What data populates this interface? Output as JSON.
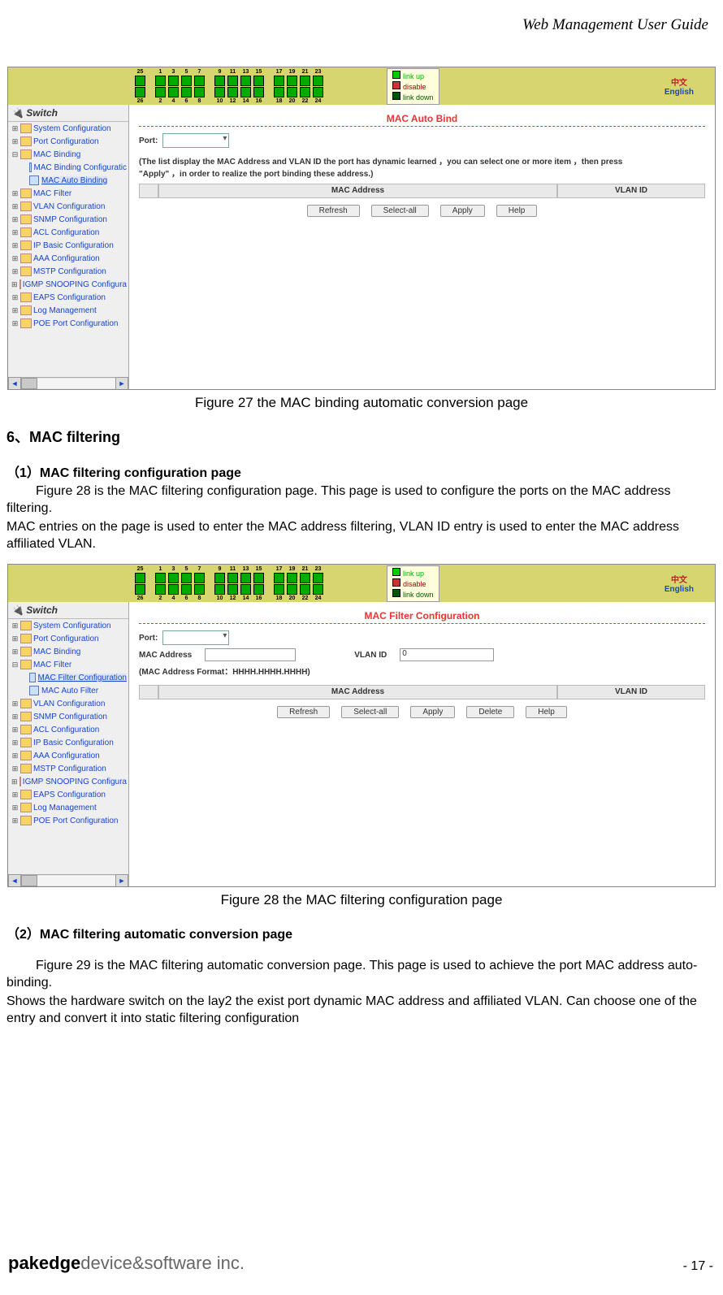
{
  "header_title": "Web Management User Guide",
  "fig27": {
    "caption": "Figure 27    the MAC binding automatic conversion page",
    "title": "MAC Auto Bind",
    "port_label": "Port:",
    "note": "(The list display the MAC Address and VLAN ID the port has dynamic learned ，you can select one or more item ，then press \"Apply\" ，in order to realize the port binding these address.)",
    "col1": "MAC Address",
    "col2": "VLAN ID",
    "buttons": [
      "Refresh",
      "Select-all",
      "Apply",
      "Help"
    ],
    "sidebar_title": "Switch",
    "tree": [
      "System Configuration",
      "Port Configuration",
      "MAC Binding",
      "MAC Binding Configuratic",
      "MAC Auto Binding",
      "MAC Filter",
      "VLAN Configuration",
      "SNMP Configuration",
      "ACL Configuration",
      "IP Basic Configuration",
      "AAA Configuration",
      "MSTP Configuration",
      "IGMP SNOOPING Configura",
      "EAPS Configuration",
      "Log Management",
      "POE Port Configuration"
    ],
    "status": [
      "link up",
      "disable",
      "link down"
    ],
    "lang_cn": "中文",
    "lang_en": "English"
  },
  "section6": {
    "heading": "6、MAC filtering",
    "sub1": "（1）MAC filtering configuration page",
    "p1a": "Figure 28 is the MAC filtering configuration page. This page is used to configure the ports on the MAC address filtering.",
    "p1b": "MAC entries on the page is used to enter the MAC address filtering, VLAN ID entry is used to enter the MAC address affiliated VLAN."
  },
  "fig28": {
    "caption": "Figure 28    the MAC filtering configuration page",
    "title": "MAC Filter Configuration",
    "port_label": "Port:",
    "mac_label": "MAC Address",
    "vlan_label": "VLAN ID",
    "vlan_value": "0",
    "format": "(MAC Address Format：HHHH.HHHH.HHHH)",
    "col1": "MAC Address",
    "col2": "VLAN ID",
    "buttons": [
      "Refresh",
      "Select-all",
      "Apply",
      "Delete",
      "Help"
    ],
    "sidebar_title": "Switch",
    "tree": [
      "System Configuration",
      "Port Configuration",
      "MAC Binding",
      "MAC Filter",
      "MAC Filter Configuration",
      "MAC Auto Filter",
      "VLAN Configuration",
      "SNMP Configuration",
      "ACL Configuration",
      "IP Basic Configuration",
      "AAA Configuration",
      "MSTP Configuration",
      "IGMP SNOOPING Configura",
      "EAPS Configuration",
      "Log Management",
      "POE Port Configuration"
    ],
    "status": [
      "link up",
      "disable",
      "link down"
    ],
    "lang_cn": "中文",
    "lang_en": "English"
  },
  "sub2": {
    "heading": "（2）MAC filtering automatic conversion page",
    "p1": "Figure 29 is the MAC filtering automatic conversion page. This page is used to achieve the port MAC address auto-binding.",
    "p2": "Shows the hardware switch on the lay2 the exist port dynamic MAC address and affiliated VLAN. Can choose one of the entry and convert it into static filtering configuration"
  },
  "footer": {
    "logo_bold": "pakedge",
    "logo_light": "device&software inc.",
    "page": "- 17 -"
  },
  "port_numbers_top": [
    "25",
    "1",
    "3",
    "5",
    "7",
    "9",
    "11",
    "13",
    "15",
    "17",
    "19",
    "21",
    "23"
  ],
  "port_numbers_bot": [
    "26",
    "2",
    "4",
    "6",
    "8",
    "10",
    "12",
    "14",
    "16",
    "18",
    "20",
    "22",
    "24"
  ]
}
